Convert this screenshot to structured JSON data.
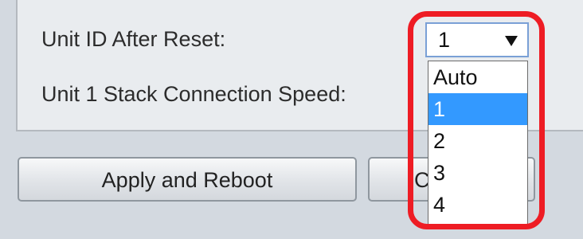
{
  "form": {
    "unit_id_label": "Unit ID After Reset:",
    "stack_speed_label": "Unit 1 Stack Connection Speed:"
  },
  "unit_id_select": {
    "value": "1",
    "options": [
      "Auto",
      "1",
      "2",
      "3",
      "4"
    ],
    "selected_index": 1
  },
  "buttons": {
    "apply_reboot": "Apply and Reboot",
    "second_partial": "C"
  },
  "colors": {
    "selected_option_bg": "#3399ff",
    "annotation_circle": "#ee1c24",
    "panel_bg": "#e9ecef",
    "page_bg": "#d3d9e0"
  },
  "icons": {
    "dropdown_arrow": "triangle-down"
  }
}
